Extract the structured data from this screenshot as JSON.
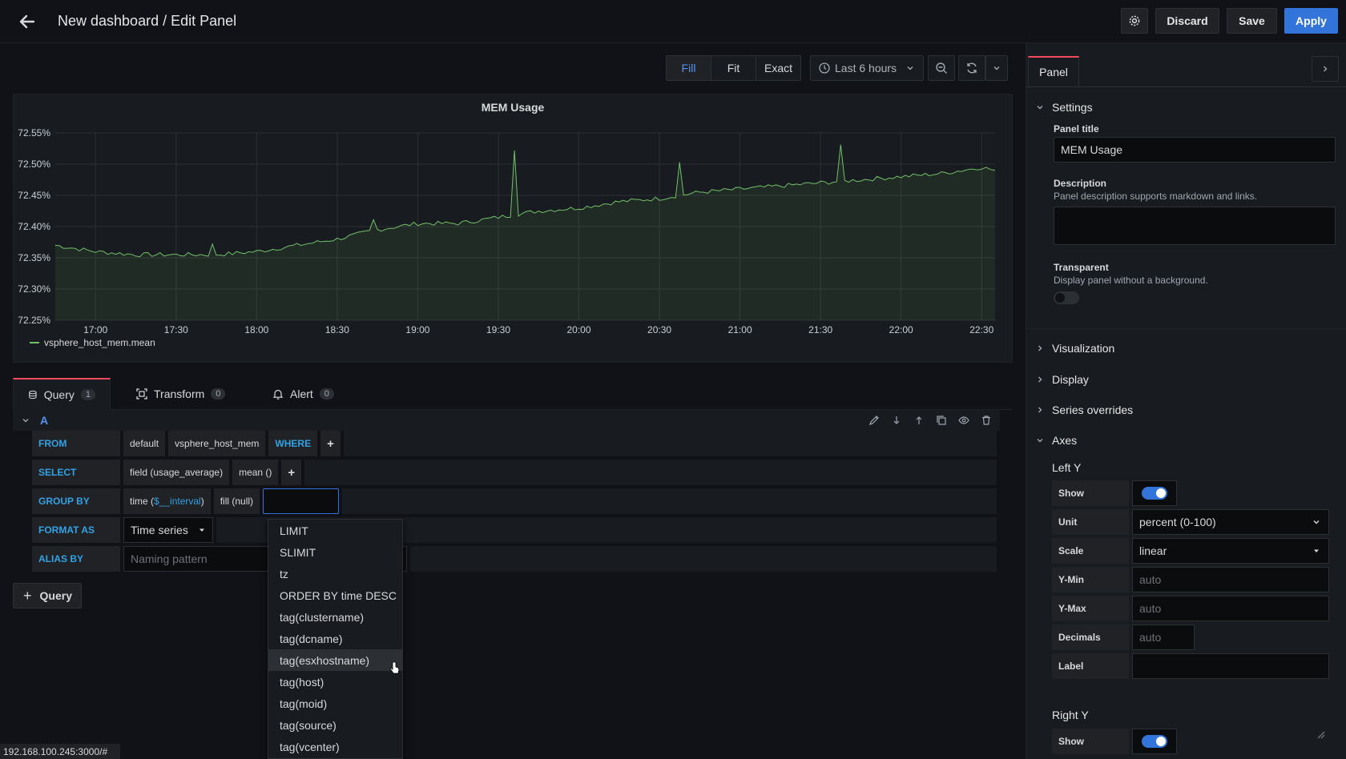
{
  "header": {
    "title": "New dashboard / Edit Panel",
    "discard_label": "Discard",
    "save_label": "Save",
    "apply_label": "Apply"
  },
  "viz_toolbar": {
    "fill": "Fill",
    "fit": "Fit",
    "exact": "Exact",
    "time_range": "Last 6 hours"
  },
  "panel": {
    "title": "MEM Usage",
    "legend_series": "vsphere_host_mem.mean"
  },
  "chart_data": {
    "type": "area",
    "title": "MEM Usage",
    "x_ticks": [
      "17:00",
      "17:30",
      "18:00",
      "18:30",
      "19:00",
      "19:30",
      "20:00",
      "20:30",
      "21:00",
      "21:30",
      "22:00",
      "22:30"
    ],
    "y_ticks": [
      "72.55%",
      "72.50%",
      "72.45%",
      "72.40%",
      "72.35%",
      "72.30%",
      "72.25%"
    ],
    "ylim": [
      72.25,
      72.55
    ],
    "series": [
      {
        "name": "vsphere_host_mem.mean",
        "color": "#73bf69",
        "x": [
          "16:45",
          "17:00",
          "17:15",
          "17:30",
          "17:45",
          "18:00",
          "18:15",
          "18:30",
          "18:45",
          "19:00",
          "19:15",
          "19:30",
          "19:45",
          "20:00",
          "20:15",
          "20:30",
          "20:45",
          "21:00",
          "21:15",
          "21:30",
          "21:45",
          "22:00",
          "22:15",
          "22:30",
          "22:35"
        ],
        "values": [
          72.37,
          72.36,
          72.355,
          72.355,
          72.355,
          72.36,
          72.37,
          72.38,
          72.395,
          72.405,
          72.405,
          72.415,
          72.425,
          72.43,
          72.44,
          72.445,
          72.455,
          72.46,
          72.465,
          72.47,
          72.475,
          72.48,
          72.485,
          72.495,
          72.49
        ]
      }
    ],
    "grid": true
  },
  "query_tabs": [
    {
      "label": "Query",
      "count": "1"
    },
    {
      "label": "Transform",
      "count": "0"
    },
    {
      "label": "Alert",
      "count": "0"
    }
  ],
  "query": {
    "ref_id": "A",
    "from_kw": "FROM",
    "from_db": "default",
    "from_measurement": "vsphere_host_mem",
    "where_kw": "WHERE",
    "select_kw": "SELECT",
    "select_field": "field (usage_average)",
    "select_fn": "mean ()",
    "groupby_kw": "GROUP BY",
    "groupby_time_prefix": "time (",
    "groupby_time_var": "$__interval",
    "groupby_time_suffix": ")",
    "groupby_fill": "fill (null)",
    "format_kw": "FORMAT AS",
    "format_value": "Time series",
    "alias_kw": "ALIAS BY",
    "alias_placeholder": "Naming pattern",
    "add_query": "Query",
    "plus": "+"
  },
  "dropdown": {
    "items": [
      "LIMIT",
      "SLIMIT",
      "tz",
      "ORDER BY time DESC",
      "tag(clustername)",
      "tag(dcname)",
      "tag(esxhostname)",
      "tag(host)",
      "tag(moid)",
      "tag(source)",
      "tag(vcenter)"
    ],
    "hovered": "tag(esxhostname)"
  },
  "options_pane": {
    "tab": "Panel",
    "settings": "Settings",
    "panel_title_label": "Panel title",
    "panel_title_value": "MEM Usage",
    "description_label": "Description",
    "description_hint": "Panel description supports markdown and links.",
    "transparent_label": "Transparent",
    "transparent_hint": "Display panel without a background.",
    "transparent_on": false,
    "visualization": "Visualization",
    "display": "Display",
    "series_overrides": "Series overrides",
    "axes": "Axes",
    "left_y": "Left Y",
    "show_label": "Show",
    "left_show_on": true,
    "unit_label": "Unit",
    "unit_value": "percent (0-100)",
    "scale_label": "Scale",
    "scale_value": "linear",
    "ymin_label": "Y-Min",
    "ymin_placeholder": "auto",
    "ymax_label": "Y-Max",
    "ymax_placeholder": "auto",
    "decimals_label": "Decimals",
    "decimals_placeholder": "auto",
    "label_label": "Label",
    "right_y": "Right Y",
    "right_show_on": true
  },
  "status_url": "192.168.100.245:3000/#"
}
